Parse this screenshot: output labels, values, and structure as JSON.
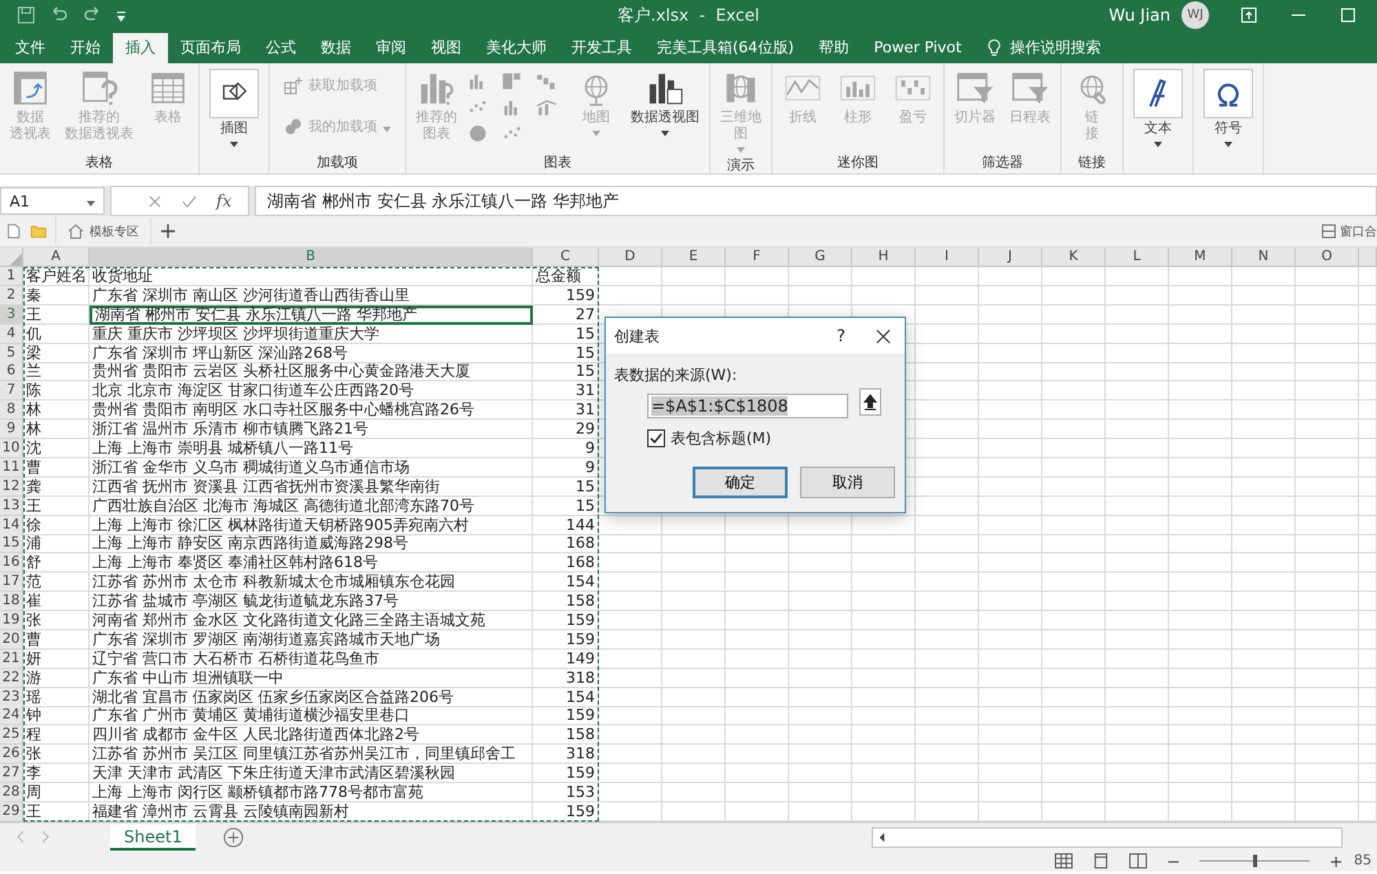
{
  "title_bar": {
    "title": "客户.xlsx  -  Excel",
    "user": "Wu Jian",
    "avatar": "WJ"
  },
  "tabs": [
    {
      "label": "文件",
      "selected": false
    },
    {
      "label": "开始",
      "selected": false
    },
    {
      "label": "插入",
      "selected": true
    },
    {
      "label": "页面布局",
      "selected": false
    },
    {
      "label": "公式",
      "selected": false
    },
    {
      "label": "数据",
      "selected": false
    },
    {
      "label": "审阅",
      "selected": false
    },
    {
      "label": "视图",
      "selected": false
    },
    {
      "label": "美化大师",
      "selected": false
    },
    {
      "label": "开发工具",
      "selected": false
    },
    {
      "label": "完美工具箱(64位版)",
      "selected": false
    },
    {
      "label": "帮助",
      "selected": false
    },
    {
      "label": "Power Pivot",
      "selected": false
    }
  ],
  "tell_me": "操作说明搜索",
  "ribbon": {
    "groups": [
      {
        "label": "表格",
        "items": [
          {
            "kind": "large",
            "lines": [
              "数据",
              "透视表"
            ],
            "disabled": true,
            "dropdown": false
          },
          {
            "kind": "large",
            "lines": [
              "推荐的",
              "数据透视表"
            ],
            "disabled": true,
            "dropdown": false
          },
          {
            "kind": "large",
            "lines": [
              "表格"
            ],
            "disabled": true,
            "dropdown": false
          }
        ]
      },
      {
        "items": [
          {
            "kind": "boxed",
            "lines": [
              "插图"
            ],
            "disabled": false,
            "dropdown": true
          }
        ]
      },
      {
        "label": "加载项",
        "items": [
          {
            "kind": "small",
            "label": "获取加载项",
            "disabled": true,
            "dropdown": false
          },
          {
            "kind": "small",
            "label": "我的加载项",
            "disabled": true,
            "dropdown": true
          }
        ]
      },
      {
        "label": "图表",
        "items": [
          {
            "kind": "large",
            "lines": [
              "推荐的",
              "图表"
            ],
            "disabled": true,
            "dropdown": false
          },
          {
            "kind": "gallery",
            "disabled": true
          },
          {
            "kind": "large",
            "lines": [
              "地图"
            ],
            "disabled": true,
            "dropdown": true
          },
          {
            "kind": "large",
            "lines": [
              "数据透视图"
            ],
            "disabled": false,
            "dropdown": true
          }
        ]
      },
      {
        "label": "演示",
        "items": [
          {
            "kind": "large",
            "lines": [
              "三维地",
              "图"
            ],
            "disabled": true,
            "dropdown": true
          }
        ]
      },
      {
        "label": "迷你图",
        "items": [
          {
            "kind": "large",
            "lines": [
              "折线"
            ],
            "disabled": true,
            "dropdown": false
          },
          {
            "kind": "large",
            "lines": [
              "柱形"
            ],
            "disabled": true,
            "dropdown": false
          },
          {
            "kind": "large",
            "lines": [
              "盈亏"
            ],
            "disabled": true,
            "dropdown": false
          }
        ]
      },
      {
        "label": "筛选器",
        "items": [
          {
            "kind": "large",
            "lines": [
              "切片器"
            ],
            "disabled": true,
            "dropdown": false
          },
          {
            "kind": "large",
            "lines": [
              "日程表"
            ],
            "disabled": true,
            "dropdown": false
          }
        ]
      },
      {
        "label": "链接",
        "items": [
          {
            "kind": "large",
            "lines": [
              "链",
              "接"
            ],
            "disabled": true,
            "dropdown": false
          }
        ]
      },
      {
        "items": [
          {
            "kind": "boxed",
            "lines": [
              "文本"
            ],
            "disabled": false,
            "dropdown": true
          }
        ]
      },
      {
        "items": [
          {
            "kind": "boxed",
            "lines": [
              "符号"
            ],
            "disabled": false,
            "dropdown": true
          }
        ]
      }
    ]
  },
  "formula_bar": {
    "name_box": "A1",
    "fx": "fx",
    "formula": "湖南省 郴州市 安仁县 永乐江镇八一路 华邦地产"
  },
  "doc_tabs": {
    "tab": "模板专区",
    "right": "窗口合"
  },
  "columns": [
    {
      "label": "A",
      "selected": false
    },
    {
      "label": "B",
      "selected": true
    },
    {
      "label": "C",
      "selected": false
    },
    {
      "label": "D",
      "selected": false
    },
    {
      "label": "E",
      "selected": false
    },
    {
      "label": "F",
      "selected": false
    },
    {
      "label": "G",
      "selected": false
    },
    {
      "label": "H",
      "selected": false
    },
    {
      "label": "I",
      "selected": false
    },
    {
      "label": "J",
      "selected": false
    },
    {
      "label": "K",
      "selected": false
    },
    {
      "label": "L",
      "selected": false
    },
    {
      "label": "M",
      "selected": false
    },
    {
      "label": "N",
      "selected": false
    },
    {
      "label": "O",
      "selected": false
    }
  ],
  "rows": [
    {
      "number": "1",
      "name": "客户姓名",
      "address": "收货地址",
      "total": "总金额",
      "selected": false
    },
    {
      "number": "2",
      "name": "秦",
      "address": "广东省 深圳市 南山区 沙河街道香山西街香山里",
      "total": "159",
      "selected": false
    },
    {
      "number": "3",
      "name": "王",
      "address": "湖南省 郴州市 安仁县 永乐江镇八一路 华邦地产",
      "total": "27",
      "selected": true
    },
    {
      "number": "4",
      "name": "仉",
      "address": "重庆 重庆市 沙坪坝区 沙坪坝街道重庆大学",
      "total": "15",
      "selected": false
    },
    {
      "number": "5",
      "name": "梁",
      "address": "广东省 深圳市 坪山新区 深汕路268号",
      "total": "15",
      "selected": false
    },
    {
      "number": "6",
      "name": "兰",
      "address": "贵州省 贵阳市 云岩区 头桥社区服务中心黄金路港天大厦",
      "total": "15",
      "selected": false
    },
    {
      "number": "7",
      "name": "陈",
      "address": "北京 北京市 海淀区 甘家口街道车公庄西路20号",
      "total": "31",
      "selected": false
    },
    {
      "number": "8",
      "name": "林",
      "address": "贵州省 贵阳市 南明区 水口寺社区服务中心蟠桃宫路26号",
      "total": "31",
      "selected": false
    },
    {
      "number": "9",
      "name": "林",
      "address": "浙江省 温州市 乐清市 柳市镇腾飞路21号",
      "total": "29",
      "selected": false
    },
    {
      "number": "10",
      "name": "沈",
      "address": "上海 上海市 崇明县 城桥镇八一路11号",
      "total": "9",
      "selected": false
    },
    {
      "number": "11",
      "name": "曹",
      "address": "浙江省 金华市 义乌市 稠城街道义乌市通信市场",
      "total": "9",
      "selected": false
    },
    {
      "number": "12",
      "name": "龚",
      "address": "江西省 抚州市 资溪县 江西省抚州市资溪县繁华南街",
      "total": "15",
      "selected": false
    },
    {
      "number": "13",
      "name": "王",
      "address": "广西壮族自治区 北海市 海城区 高德街道北部湾东路70号",
      "total": "15",
      "selected": false
    },
    {
      "number": "14",
      "name": "徐",
      "address": "上海 上海市 徐汇区 枫林路街道天钥桥路905弄宛南六村",
      "total": "144",
      "selected": false
    },
    {
      "number": "15",
      "name": "浦",
      "address": "上海 上海市 静安区 南京西路街道威海路298号",
      "total": "168",
      "selected": false
    },
    {
      "number": "16",
      "name": "舒",
      "address": "上海 上海市 奉贤区 奉浦社区韩村路618号",
      "total": "168",
      "selected": false
    },
    {
      "number": "17",
      "name": "范",
      "address": "江苏省 苏州市 太仓市 科教新城太仓市城厢镇东仓花园",
      "total": "154",
      "selected": false
    },
    {
      "number": "18",
      "name": "崔",
      "address": "江苏省 盐城市 亭湖区 毓龙街道毓龙东路37号",
      "total": "158",
      "selected": false
    },
    {
      "number": "19",
      "name": "张",
      "address": "河南省 郑州市 金水区 文化路街道文化路三全路主语城文苑",
      "total": "159",
      "selected": false
    },
    {
      "number": "20",
      "name": "曹",
      "address": "广东省 深圳市 罗湖区 南湖街道嘉宾路城市天地广场",
      "total": "159",
      "selected": false
    },
    {
      "number": "21",
      "name": "妍",
      "address": "辽宁省 营口市 大石桥市 石桥街道花鸟鱼市",
      "total": "149",
      "selected": false
    },
    {
      "number": "22",
      "name": "游",
      "address": "广东省 中山市 坦洲镇联一中",
      "total": "318",
      "selected": false
    },
    {
      "number": "23",
      "name": "瑶",
      "address": "湖北省 宜昌市 伍家岗区 伍家乡伍家岗区合益路206号",
      "total": "154",
      "selected": false
    },
    {
      "number": "24",
      "name": "钟",
      "address": "广东省 广州市 黄埔区 黄埔街道横沙福安里巷口",
      "total": "159",
      "selected": false
    },
    {
      "number": "25",
      "name": "程",
      "address": "四川省 成都市 金牛区 人民北路街道西体北路2号",
      "total": "158",
      "selected": false
    },
    {
      "number": "26",
      "name": "张",
      "address": "江苏省 苏州市 吴江区 同里镇江苏省苏州吴江市，同里镇邱舍工",
      "total": "318",
      "selected": false
    },
    {
      "number": "27",
      "name": "李",
      "address": "天津 天津市 武清区 下朱庄街道天津市武清区碧溪秋园",
      "total": "159",
      "selected": false
    },
    {
      "number": "28",
      "name": "周",
      "address": "上海 上海市 闵行区 颛桥镇都市路778号都市富苑",
      "total": "153",
      "selected": false
    },
    {
      "number": "29",
      "name": "王",
      "address": "福建省 漳州市 云霄县 云陵镇南园新村",
      "total": "159",
      "selected": false
    }
  ],
  "dialog": {
    "title": "创建表",
    "help": "?",
    "source_label": "表数据的来源(W):",
    "source_value": "=$A$1:$C$1808",
    "headers_label": "表包含标题(M)",
    "headers_checked": true,
    "buttons": [
      {
        "label": "确定",
        "default": true
      },
      {
        "label": "取消",
        "default": false
      }
    ]
  },
  "sheet_tabs": [
    {
      "label": "Sheet1",
      "selected": true
    }
  ],
  "zoom": {
    "level": 0.5,
    "minus": "−",
    "plus": "+",
    "percent": "85"
  }
}
